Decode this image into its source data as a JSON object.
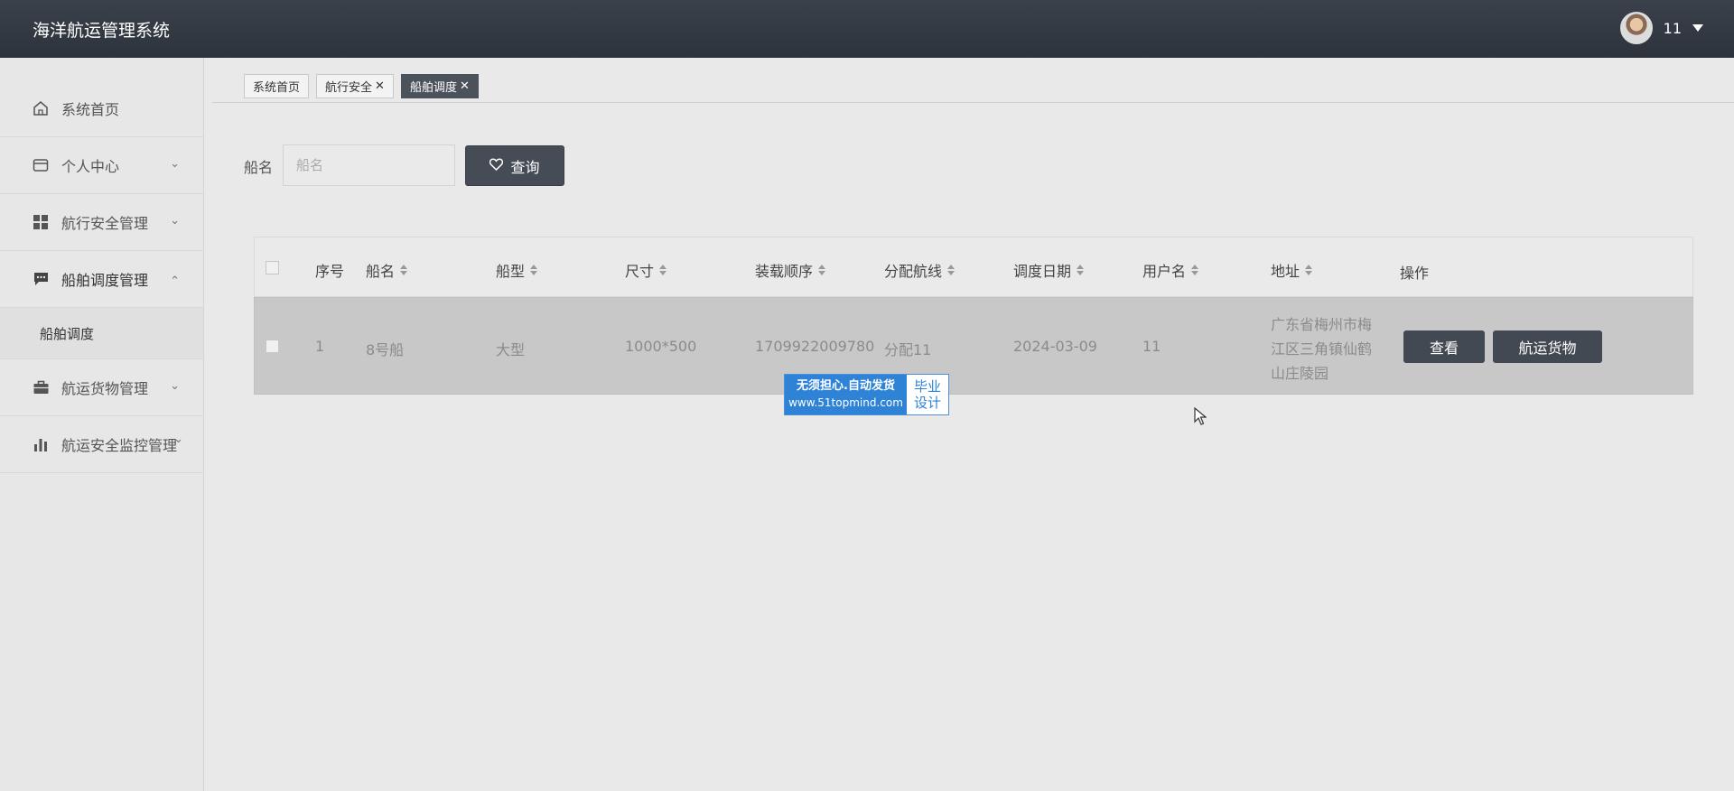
{
  "header": {
    "app_title": "海洋航运管理系统",
    "username": "11"
  },
  "sidebar": {
    "items": [
      {
        "label": "系统首页",
        "icon": "home-icon"
      },
      {
        "label": "个人中心",
        "icon": "card-icon"
      },
      {
        "label": "航行安全管理",
        "icon": "grid-icon"
      },
      {
        "label": "船舶调度管理",
        "icon": "chat-icon"
      },
      {
        "label": "航运货物管理",
        "icon": "briefcase-icon"
      },
      {
        "label": "航运安全监控管理",
        "icon": "bar-chart-icon"
      }
    ],
    "active_sub": "船舶调度"
  },
  "tabs": [
    {
      "label": "系统首页"
    },
    {
      "label": "航行安全"
    },
    {
      "label": "船舶调度"
    }
  ],
  "search": {
    "label": "船名",
    "placeholder": "船名",
    "button": "查询"
  },
  "table": {
    "headers": [
      "序号",
      "船名",
      "船型",
      "尺寸",
      "装载顺序",
      "分配航线",
      "调度日期",
      "用户名",
      "地址",
      "操作"
    ],
    "rows": [
      {
        "index": "1",
        "ship_name": "8号船",
        "ship_type": "大型",
        "size": "1000*500",
        "load_order": "1709922009780",
        "route": "分配11",
        "date": "2024-03-09",
        "username": "11",
        "address": "广东省梅州市梅江区三角镇仙鹤山庄陵园",
        "actions": [
          "查看",
          "航运货物"
        ]
      }
    ]
  },
  "watermark": {
    "line1": "无须担心.自动发货",
    "line2": "www.51topmind.com",
    "right1": "毕业",
    "right2": "设计"
  }
}
